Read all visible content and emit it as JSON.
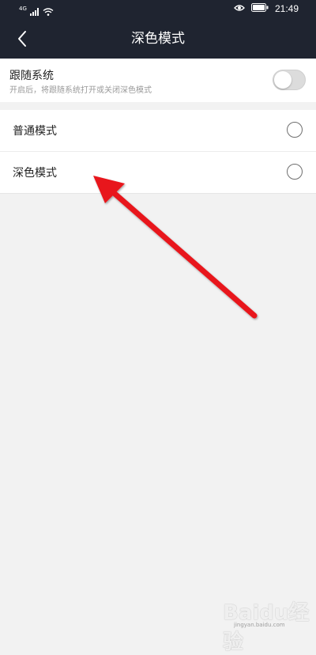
{
  "status_bar": {
    "network": "4G",
    "time": "21:49"
  },
  "nav": {
    "title": "深色模式",
    "back_icon": "chevron-left-icon"
  },
  "follow_system": {
    "title": "跟随系统",
    "subtitle": "开启后，将跟随系统打开或关闭深色模式",
    "enabled": false
  },
  "options": [
    {
      "label": "普通模式",
      "selected": false
    },
    {
      "label": "深色模式",
      "selected": false
    }
  ],
  "watermark": {
    "logo_text": "Baidu经验",
    "url": "jingyan.baidu.com"
  },
  "colors": {
    "header_bg": "#1f2430",
    "annotation_arrow": "#e8141a"
  }
}
